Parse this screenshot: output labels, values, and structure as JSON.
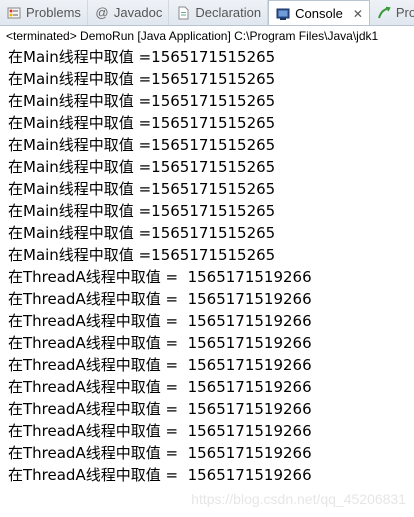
{
  "tabs": [
    {
      "label": "Problems",
      "icon": "problems-icon"
    },
    {
      "label": "Javadoc",
      "icon": "at-sign-icon"
    },
    {
      "label": "Declaration",
      "icon": "declaration-icon"
    },
    {
      "label": "Console",
      "icon": "console-icon",
      "active": true
    },
    {
      "label": "Progre",
      "icon": "progress-icon"
    }
  ],
  "tab_close_label": "✕",
  "status_text": "<terminated> DemoRun [Java Application] C:\\Program Files\\Java\\jdk1",
  "console_lines": [
    "在Main线程中取值 =1565171515265",
    "在Main线程中取值 =1565171515265",
    "在Main线程中取值 =1565171515265",
    "在Main线程中取值 =1565171515265",
    "在Main线程中取值 =1565171515265",
    "在Main线程中取值 =1565171515265",
    "在Main线程中取值 =1565171515265",
    "在Main线程中取值 =1565171515265",
    "在Main线程中取值 =1565171515265",
    "在Main线程中取值 =1565171515265",
    "在ThreadA线程中取值 =  1565171519266",
    "在ThreadA线程中取值 =  1565171519266",
    "在ThreadA线程中取值 =  1565171519266",
    "在ThreadA线程中取值 =  1565171519266",
    "在ThreadA线程中取值 =  1565171519266",
    "在ThreadA线程中取值 =  1565171519266",
    "在ThreadA线程中取值 =  1565171519266",
    "在ThreadA线程中取值 =  1565171519266",
    "在ThreadA线程中取值 =  1565171519266",
    "在ThreadA线程中取值 =  1565171519266"
  ],
  "watermark": "https://blog.csdn.net/qq_45206831"
}
